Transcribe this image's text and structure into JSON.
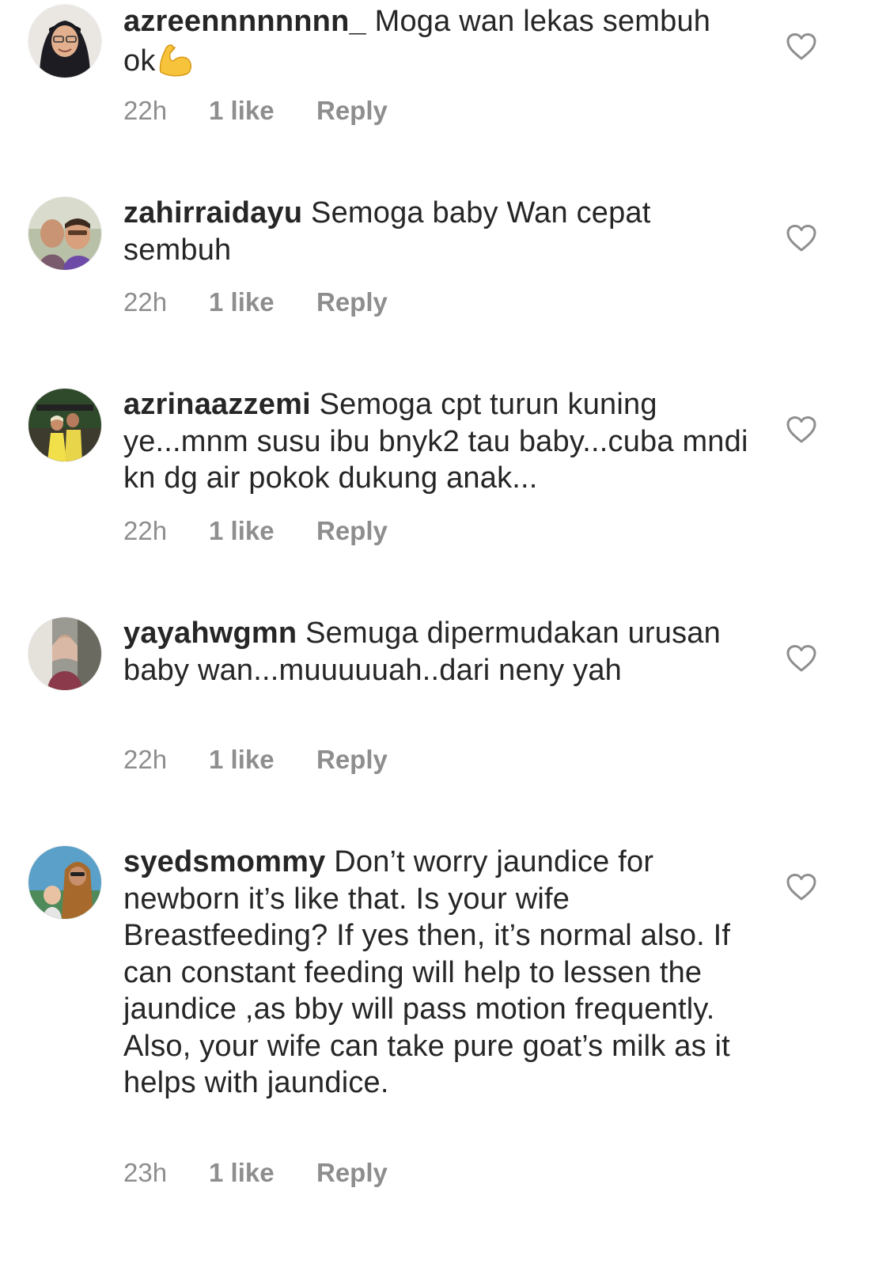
{
  "comments": [
    {
      "username": "azreennnnnnnn_",
      "text": "Moga wan lekas sembuh ok",
      "emoji": "flexed-biceps",
      "time": "22h",
      "likes": "1 like",
      "reply": "Reply"
    },
    {
      "username": "zahirraidayu",
      "text": "Semoga baby Wan cepat sembuh",
      "time": "22h",
      "likes": "1 like",
      "reply": "Reply"
    },
    {
      "username": "azrinaazzemi",
      "text": "Semoga cpt turun kuning ye...mnm susu ibu bnyk2 tau baby...cuba mndi kn dg air pokok dukung anak...",
      "time": "22h",
      "likes": "1 like",
      "reply": "Reply"
    },
    {
      "username": "yayahwgmn",
      "text": "Semuga dipermudakan urusan baby wan...muuuuuah..dari neny yah",
      "time": "22h",
      "likes": "1 like",
      "reply": "Reply"
    },
    {
      "username": "syedsmommy",
      "text": "Don’t worry jaundice for newborn it’s like that. Is your wife Breastfeeding? If yes then, it’s normal also. If can constant feeding will help to lessen the jaundice ,as bby will pass motion frequently. Also, your wife can take pure goat’s milk as it helps with jaundice.",
      "time": "23h",
      "likes": "1 like",
      "reply": "Reply"
    }
  ],
  "icons": {
    "like": "heart-outline-icon",
    "emoji": "flexed-biceps-emoji"
  },
  "colors": {
    "text": "#262626",
    "meta": "#8e8e8e",
    "heart": "#8e8e8e"
  }
}
